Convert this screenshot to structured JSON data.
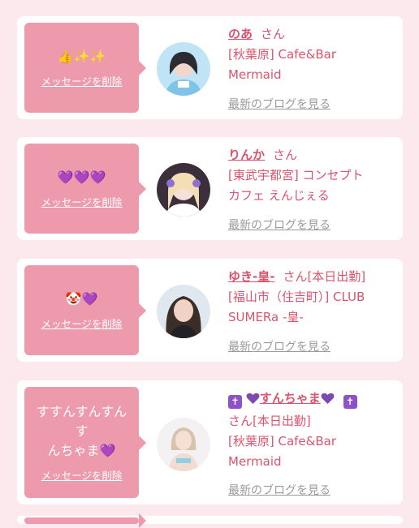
{
  "cards": [
    {
      "message": "👍✨✨",
      "delete_label": "メッセージを削除",
      "name": "のあ",
      "honorific": "さん",
      "shop_lines": [
        "[秋葉原] Cafe&Bar",
        "Mermaid"
      ],
      "blog_label": "最新のブログを見る"
    },
    {
      "message": "💜💜💜",
      "delete_label": "メッセージを削除",
      "name": "りんか",
      "honorific": "さん",
      "shop_lines": [
        "[東武宇都宮] コンセプト",
        "カフェ えんじぇる"
      ],
      "blog_label": "最新のブログを見る"
    },
    {
      "message": "🤡💜",
      "delete_label": "メッセージを削除",
      "name": "ゆき-皇-",
      "honorific": "さん[本日出勤]",
      "shop_lines": [
        "[福山市（住吉町）] CLUB",
        "SUMERa -皇-"
      ],
      "blog_label": "最新のブログを見る"
    },
    {
      "message_lines": [
        "すすんすんすんす",
        "んちゃま💜"
      ],
      "delete_label": "メッセージを削除",
      "name": "すんちゃま",
      "honorific": "さん[本日出勤]",
      "shop_lines": [
        "[秋葉原] Cafe&Bar",
        "Mermaid"
      ],
      "blog_label": "最新のブログを見る"
    }
  ],
  "colors": {
    "background": "#fbe9ee",
    "bubble": "#ee9aad",
    "accent_text": "#d9546c",
    "muted_link": "#9a9a9a"
  }
}
